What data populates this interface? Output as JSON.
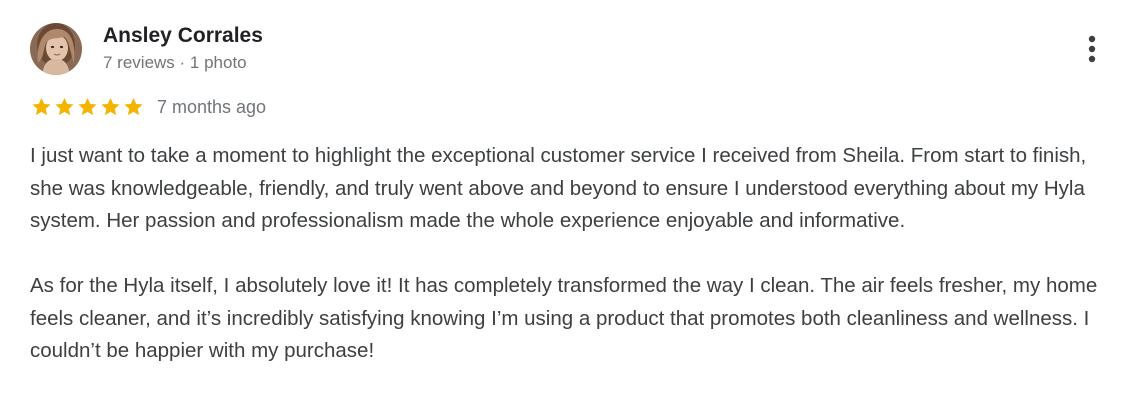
{
  "reviewer": {
    "name": "Ansley Corrales",
    "meta": "7 reviews · 1 photo",
    "avatar_icon": "user-avatar-photo"
  },
  "menu": {
    "icon": "more-vertical-icon"
  },
  "rating": {
    "stars": 5,
    "max_stars": 5,
    "star_color": "#f4b400",
    "time_ago": "7 months ago"
  },
  "review": {
    "paragraphs": [
      "I just want to take a moment to highlight the exceptional customer service I received from Sheila. From start to finish, she was knowledgeable, friendly, and truly went above and beyond to ensure I understood everything about my Hyla system. Her passion and professionalism made the whole experience enjoyable and informative.",
      "As for the Hyla itself, I absolutely love it! It has completely transformed the way I clean. The air feels fresher, my home feels cleaner, and it’s incredibly satisfying knowing I’m using a product that promotes both cleanliness and wellness. I couldn’t be happier with my purchase!"
    ]
  }
}
